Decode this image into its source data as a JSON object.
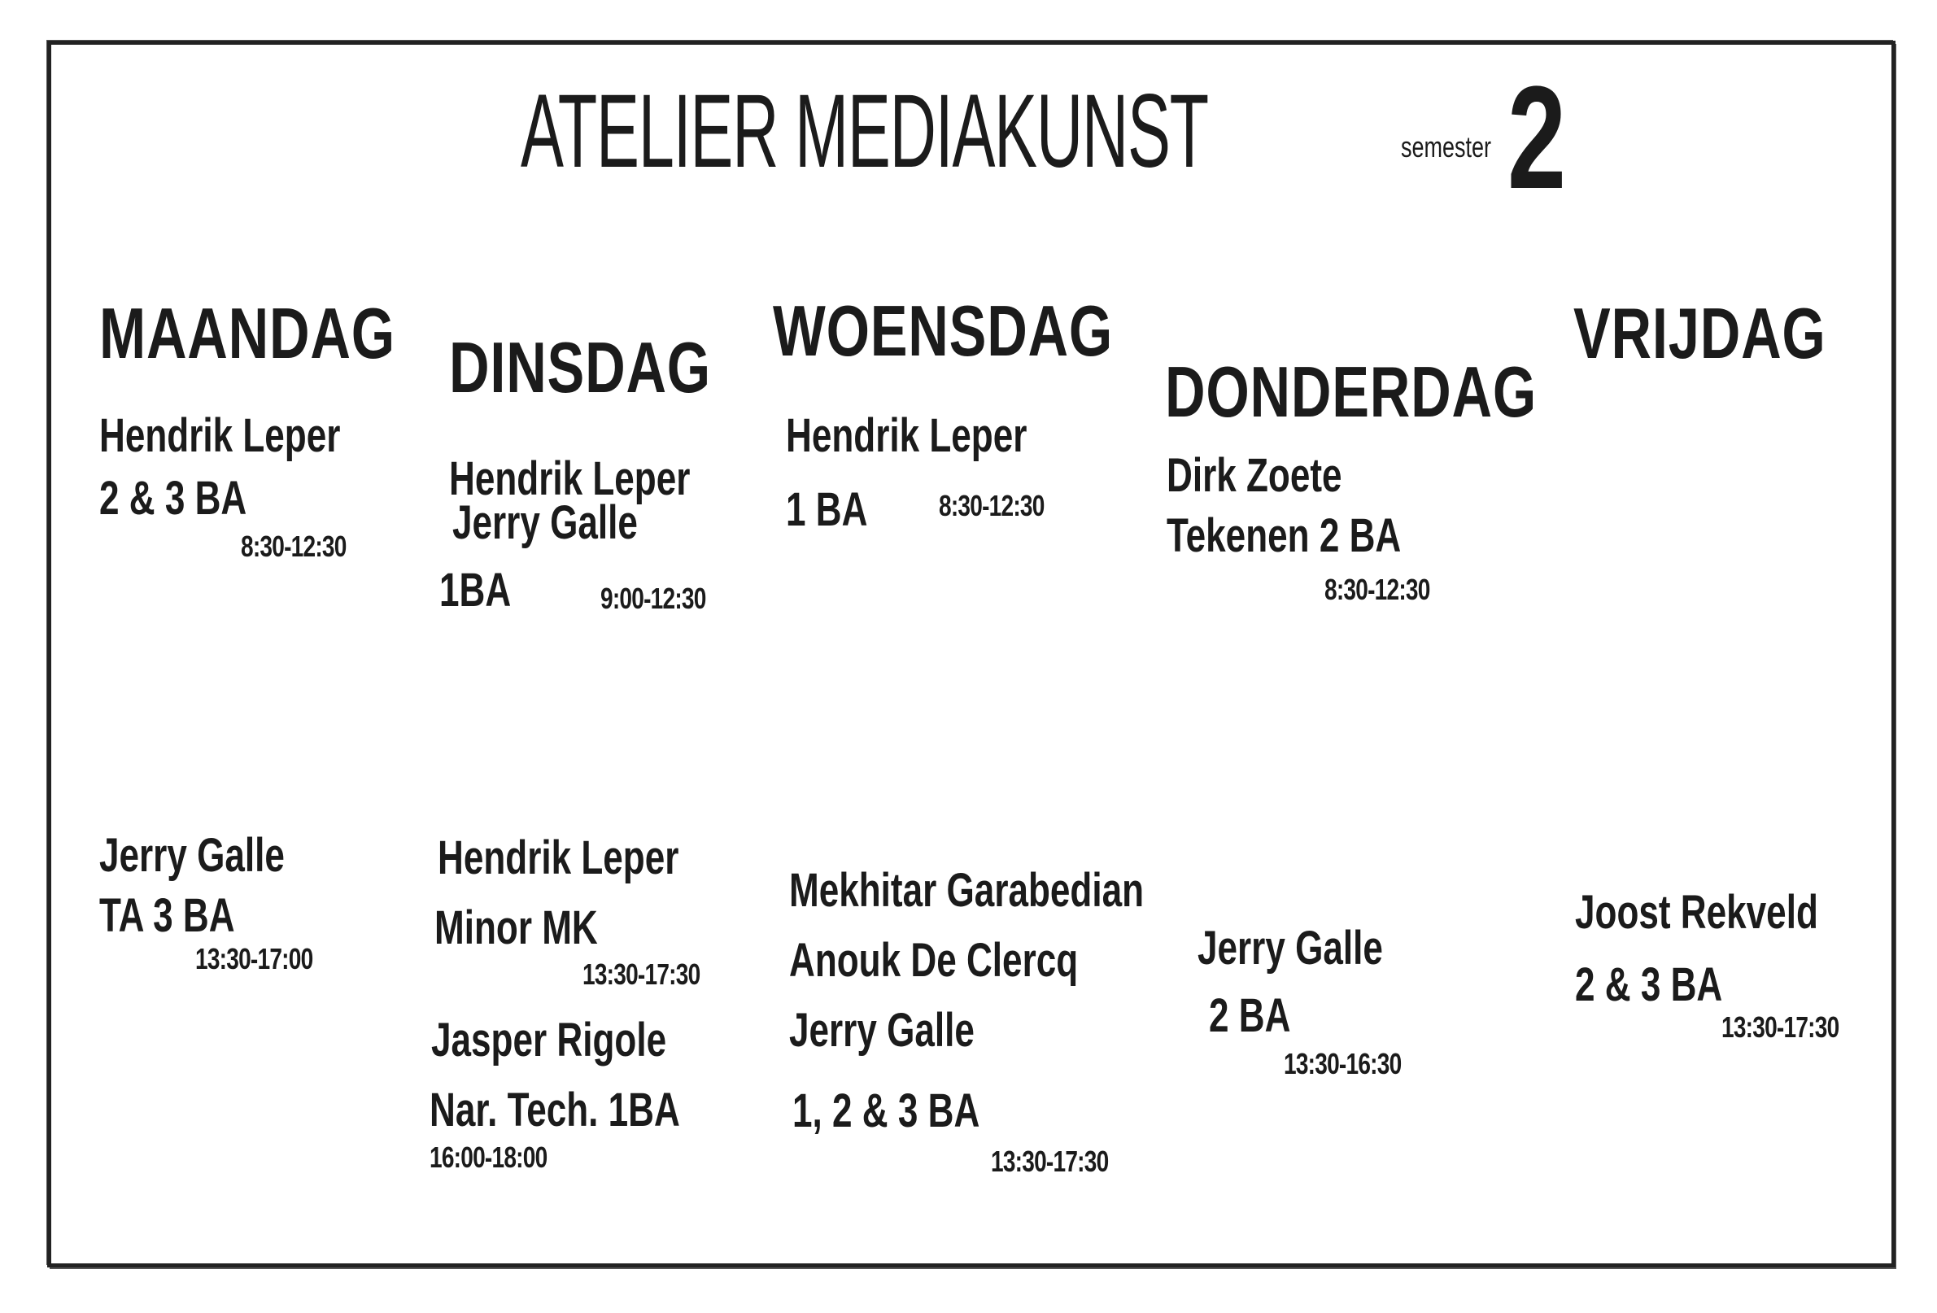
{
  "header": {
    "title": "ATELIER MEDIAKUNST",
    "semester_label": "semester",
    "semester_number": "2"
  },
  "days": {
    "maandag": "MAANDAG",
    "dinsdag": "DINSDAG",
    "woensdag": "WOENSDAG",
    "donderdag": "DONDERDAG",
    "vrijdag": "VRIJDAG"
  },
  "morning": {
    "maandag": {
      "l1": "Hendrik Leper",
      "l2": "2 & 3 BA",
      "time": "8:30-12:30"
    },
    "dinsdag": {
      "l1": "Hendrik Leper",
      "l2": "Jerry Galle",
      "l3": "1BA",
      "time": "9:00-12:30"
    },
    "woensdag": {
      "l1": "Hendrik Leper",
      "l2": "1 BA",
      "time": "8:30-12:30"
    },
    "donderdag": {
      "l1": "Dirk Zoete",
      "l2": "Tekenen 2 BA",
      "time": "8:30-12:30"
    }
  },
  "afternoon": {
    "maandag": {
      "l1": "Jerry Galle",
      "l2": "TA 3 BA",
      "time": "13:30-17:00"
    },
    "dinsdag": {
      "l1": "Hendrik Leper",
      "l2": "Minor MK",
      "time1": "13:30-17:30",
      "l3": "Jasper Rigole",
      "l4": "Nar. Tech. 1BA",
      "time2": "16:00-18:00"
    },
    "woensdag": {
      "l1": "Mekhitar Garabedian",
      "l2": "Anouk De Clercq",
      "l3": "Jerry Galle",
      "l4": "1, 2 & 3 BA",
      "time": "13:30-17:30"
    },
    "donderdag": {
      "l1": "Jerry Galle",
      "l2": "2 BA",
      "time": "13:30-16:30"
    },
    "vrijdag": {
      "l1": "Joost Rekveld",
      "l2": "2 & 3 BA",
      "time": "13:30-17:30"
    }
  }
}
